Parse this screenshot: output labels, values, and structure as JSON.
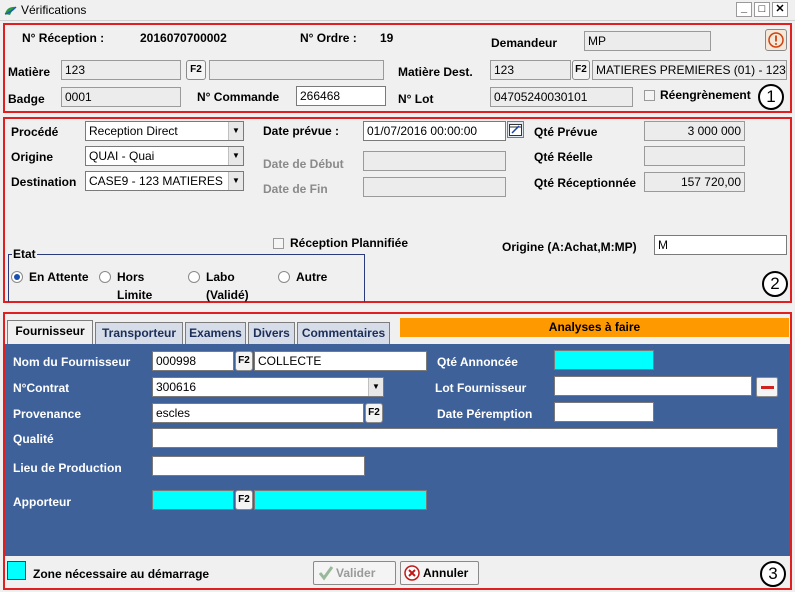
{
  "window": {
    "title": "Vérifications",
    "min_label": "_",
    "max_label": "□",
    "close_label": "✕"
  },
  "section1": {
    "reception_label": "N° Réception :",
    "reception_value": "2016070700002",
    "ordre_label": "N° Ordre :",
    "ordre_value": "19",
    "demandeur_label": "Demandeur",
    "demandeur_value": "MP",
    "matiere_label": "Matière",
    "matiere_code": "123",
    "matiere_f2": "F2",
    "matiere_desc": "",
    "matiere_dest_label": "Matière Dest.",
    "matiere_dest_code": "123",
    "matiere_dest_f2": "F2",
    "matiere_dest_desc": "MATIERES PREMIERES (01) - 123",
    "badge_label": "Badge",
    "badge_value": "0001",
    "commande_label": "N° Commande",
    "commande_value": "266468",
    "lot_label": "N° Lot",
    "lot_value": "04705240030101",
    "reengrenement_label": "Réengrènement",
    "marker": "1"
  },
  "section2": {
    "procede_label": "Procédé",
    "procede_value": "Reception Direct",
    "origine_label": "Origine",
    "origine_value": "QUAI - Quai",
    "destination_label": "Destination",
    "destination_value": "CASE9 - 123 MATIERES",
    "date_prevue_label": "Date prévue :",
    "date_prevue_value": "01/07/2016 00:00:00",
    "date_debut_label": "Date de Début",
    "date_debut_value": "",
    "date_fin_label": "Date de Fin",
    "date_fin_value": "",
    "qte_prevue_label": "Qté Prévue",
    "qte_prevue_value": "3 000 000",
    "qte_reelle_label": "Qté Réelle",
    "qte_reelle_value": "",
    "qte_receptionnee_label": "Qté Réceptionnée",
    "qte_receptionnee_value": "157 720,00",
    "reception_planifiee_label": "Réception Plannifiée",
    "origine_achat_label": "Origine (A:Achat,M:MP)",
    "origine_achat_value": "M",
    "etat_label": "Etat",
    "etat_options": [
      "En Attente",
      "Hors",
      "Limite",
      "Labo",
      "(Validé)",
      "Autre"
    ],
    "marker": "2"
  },
  "section3": {
    "tabs": [
      "Fournisseur",
      "Transporteur",
      "Examens",
      "Divers",
      "Commentaires"
    ],
    "analyses_label": "Analyses à faire",
    "nom_fournisseur_label": "Nom du Fournisseur",
    "nom_fournisseur_code": "000998",
    "nom_fournisseur_f2": "F2",
    "nom_fournisseur_value": "COLLECTE",
    "qte_annoncee_label": "Qté Annoncée",
    "qte_annoncee_value": "",
    "contrat_label": "N°Contrat",
    "contrat_value": "300616",
    "lot_fournisseur_label": "Lot Fournisseur",
    "lot_fournisseur_value": "",
    "provenance_label": "Provenance",
    "provenance_value": "escles",
    "provenance_f2": "F2",
    "date_peremption_label": "Date Péremption",
    "date_peremption_value": "",
    "qualite_label": "Qualité",
    "qualite_value": "",
    "lieu_label": "Lieu de Production",
    "lieu_value": "",
    "apporteur_label": "Apporteur",
    "apporteur_f2": "F2",
    "apporteur_code": "",
    "apporteur_value": "",
    "legend_label": "Zone nécessaire au démarrage",
    "valider_label": "Valider",
    "annuler_label": "Annuler",
    "marker": "3"
  },
  "colors": {
    "accent_red": "#e02020",
    "panel_blue": "#3e6199",
    "required_cyan": "#00ffff",
    "analyses_orange": "#ff9900"
  }
}
